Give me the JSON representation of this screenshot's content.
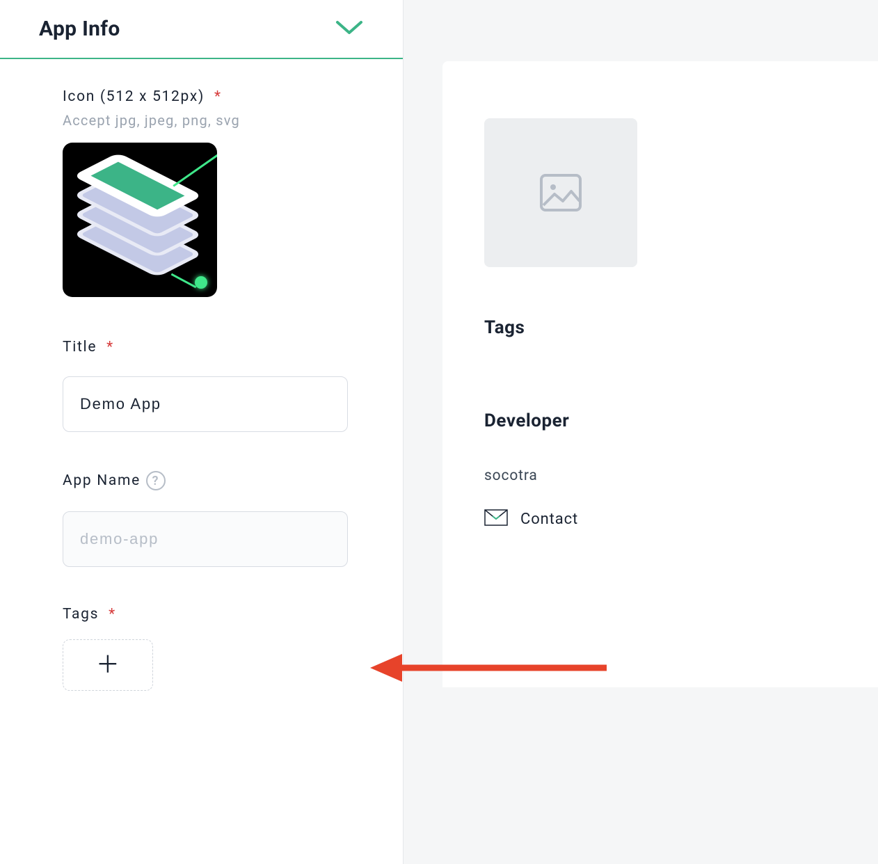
{
  "section": {
    "title": "App Info"
  },
  "fields": {
    "icon": {
      "label": "Icon (512 x 512px)",
      "required": "*",
      "helper": "Accept jpg, jpeg, png, svg"
    },
    "title": {
      "label": "Title",
      "required": "*",
      "value": "Demo App"
    },
    "appname": {
      "label": "App Name",
      "value": "demo-app"
    },
    "tags": {
      "label": "Tags",
      "required": "*"
    }
  },
  "sidebar": {
    "tags_heading": "Tags",
    "developer_heading": "Developer",
    "developer_name": "socotra",
    "contact_label": "Contact"
  }
}
